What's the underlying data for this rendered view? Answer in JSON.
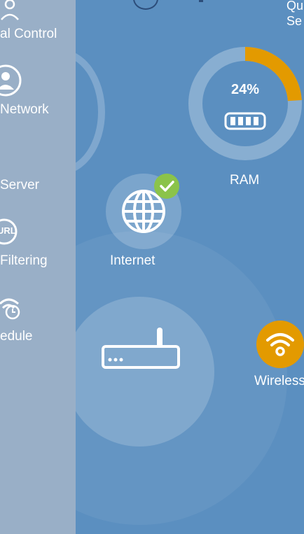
{
  "sidebar": {
    "items": [
      {
        "label": "al Control",
        "icon": "parental-control-icon"
      },
      {
        "label": "Network",
        "icon": "user-icon"
      },
      {
        "label": "Server",
        "icon": ""
      },
      {
        "label": "Filtering",
        "icon": "url-icon",
        "icon_text": "URL"
      },
      {
        "label": "edule",
        "icon": "schedule-icon"
      }
    ]
  },
  "top": {
    "qos_line1": "Qu",
    "qos_line2": "Se"
  },
  "ram": {
    "percent": "24%",
    "usage_fraction": 0.24,
    "label": "RAM"
  },
  "internet": {
    "label": "Internet",
    "status": "connected"
  },
  "router": {
    "icon": "router-icon"
  },
  "wireless": {
    "label": "Wireless",
    "icon": "wifi-icon"
  },
  "colors": {
    "background": "#5b8fc0",
    "sidebar": "#99afc7",
    "accent_orange": "#e39a00",
    "check_green": "#8bc34a"
  }
}
